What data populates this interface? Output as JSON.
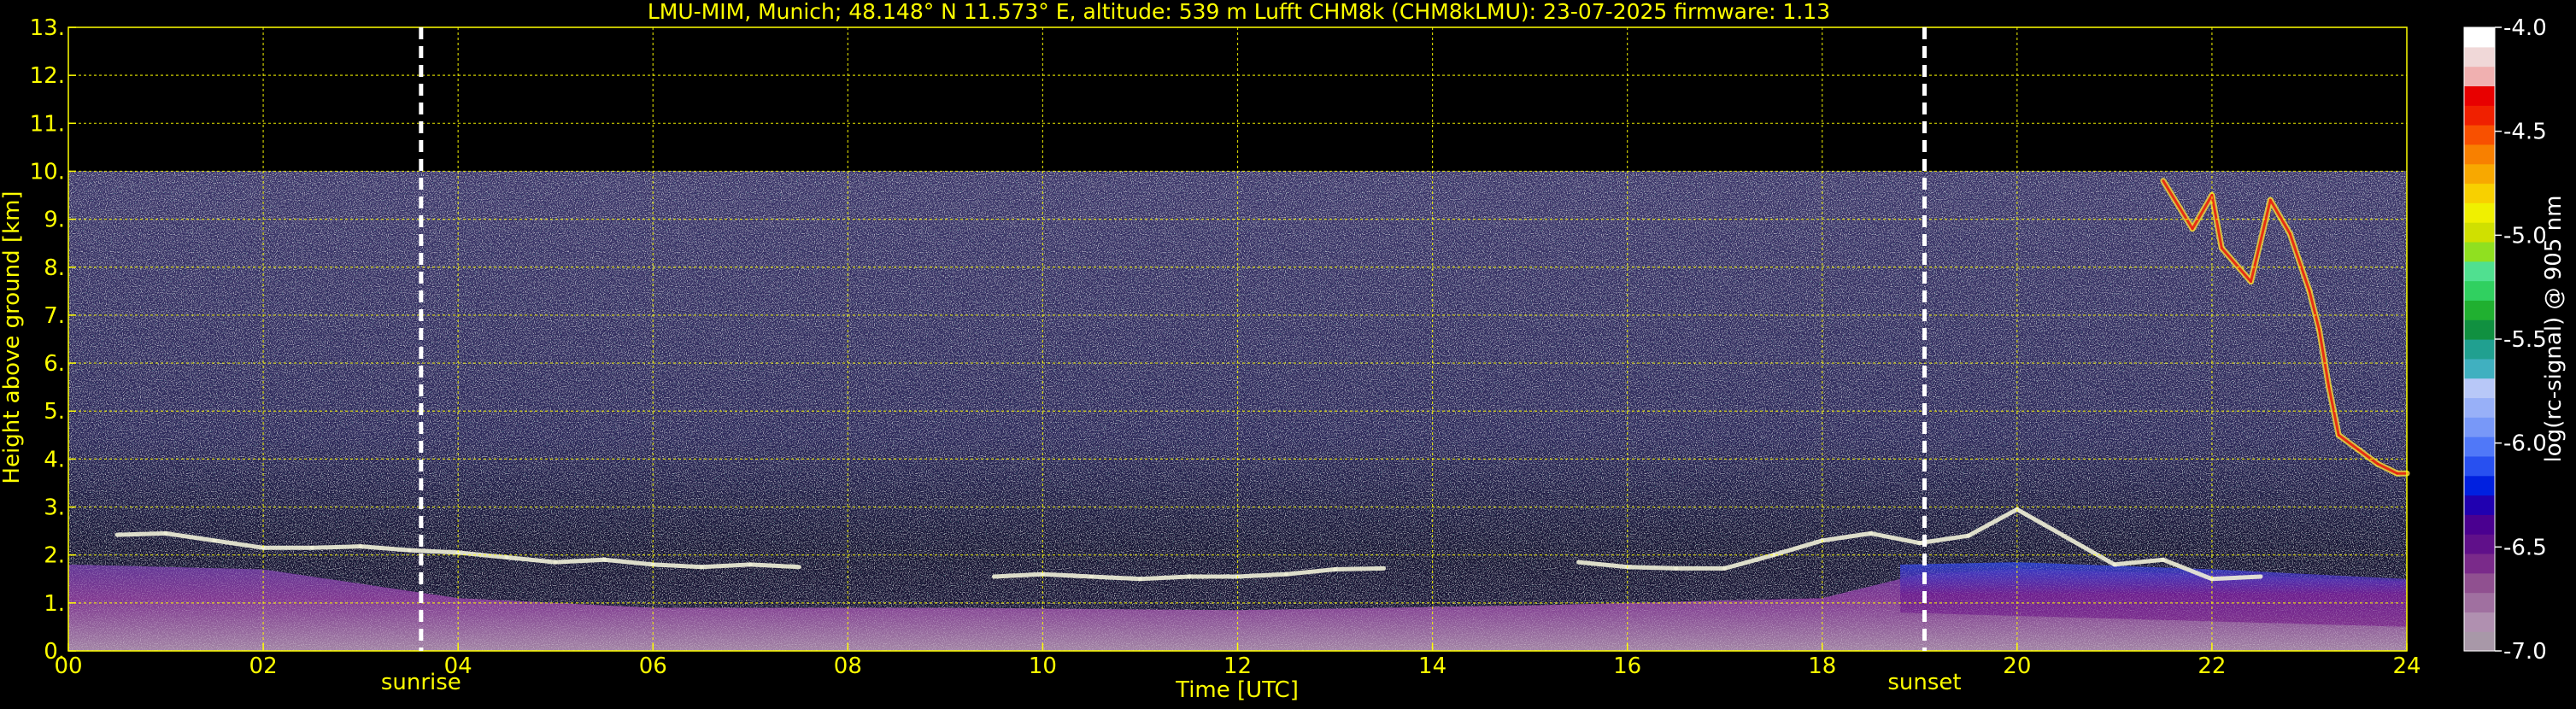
{
  "chart_data": {
    "type": "heatmap",
    "title": "LMU-MIM, Munich; 48.148° N 11.573° E, altitude: 539 m    Lufft CHM8k (CHM8kLMU): 23-07-2025    firmware: 1.13",
    "xlabel": "Time [UTC]",
    "ylabel": "Height above ground [km]",
    "xlim": [
      0,
      24
    ],
    "ylim": [
      0,
      13
    ],
    "xticks": [
      0,
      2,
      4,
      6,
      8,
      10,
      12,
      14,
      16,
      18,
      20,
      22,
      24
    ],
    "xtick_labels": [
      "00",
      "02",
      "04",
      "06",
      "08",
      "10",
      "12",
      "14",
      "16",
      "18",
      "20",
      "22",
      "24"
    ],
    "yticks": [
      0,
      1,
      2,
      3,
      4,
      5,
      6,
      7,
      8,
      9,
      10,
      11,
      12,
      13
    ],
    "ytick_labels": [
      "0.",
      "1.",
      "2.",
      "3.",
      "4.",
      "5.",
      "6.",
      "7.",
      "8.",
      "9.",
      "10.",
      "11.",
      "12.",
      "13."
    ],
    "grid": true,
    "data_top_km": 10,
    "colorbar": {
      "label": "log(rc-signal) @ 905 nm",
      "range": [
        -7.0,
        -4.0
      ],
      "ticks": [
        -7.0,
        -6.5,
        -6.0,
        -5.5,
        -5.0,
        -4.5,
        -4.0
      ],
      "tick_labels": [
        "-7.0",
        "-6.5",
        "-6.0",
        "-5.5",
        "-5.0",
        "-4.5",
        "-4.0"
      ],
      "colors": [
        "#a898a8",
        "#b090b0",
        "#a070a0",
        "#905090",
        "#7a2a8a",
        "#60108a",
        "#4a0090",
        "#2000b0",
        "#0020e0",
        "#2850f0",
        "#5078f8",
        "#7898f8",
        "#98b0f8",
        "#b8c8f8",
        "#40b0c0",
        "#20a090",
        "#109040",
        "#20b030",
        "#30d060",
        "#50e090",
        "#90e020",
        "#d0e000",
        "#f0f000",
        "#f8d000",
        "#f8a800",
        "#f88000",
        "#f85000",
        "#f02000",
        "#e80000",
        "#f0b0b0",
        "#f0d8d8",
        "#ffffff"
      ]
    },
    "events": [
      {
        "label": "sunrise",
        "time_h": 3.62
      },
      {
        "label": "sunset",
        "time_h": 19.05
      }
    ],
    "layers": [
      {
        "kind": "cloud",
        "points": [
          [
            0.5,
            2.42
          ],
          [
            1.0,
            2.45
          ],
          [
            1.5,
            2.3
          ],
          [
            2.0,
            2.15
          ],
          [
            2.5,
            2.15
          ],
          [
            3.0,
            2.18
          ],
          [
            3.5,
            2.1
          ],
          [
            4.0,
            2.05
          ],
          [
            4.5,
            1.95
          ],
          [
            5.0,
            1.85
          ],
          [
            5.5,
            1.9
          ],
          [
            6.0,
            1.8
          ],
          [
            6.5,
            1.75
          ],
          [
            7.0,
            1.8
          ],
          [
            7.5,
            1.75
          ],
          [
            9.5,
            1.55
          ],
          [
            10.0,
            1.6
          ],
          [
            10.5,
            1.55
          ],
          [
            11.0,
            1.5
          ],
          [
            11.5,
            1.55
          ],
          [
            12.0,
            1.55
          ],
          [
            12.5,
            1.6
          ],
          [
            13.0,
            1.7
          ],
          [
            13.5,
            1.72
          ],
          [
            15.5,
            1.85
          ],
          [
            16.0,
            1.75
          ],
          [
            16.5,
            1.72
          ],
          [
            17.0,
            1.72
          ],
          [
            17.5,
            2.0
          ],
          [
            18.0,
            2.3
          ],
          [
            18.5,
            2.45
          ],
          [
            19.0,
            2.25
          ],
          [
            19.5,
            2.4
          ],
          [
            20.0,
            2.95
          ],
          [
            21.0,
            1.8
          ],
          [
            21.5,
            1.9
          ],
          [
            22.0,
            1.5
          ],
          [
            22.5,
            1.55
          ]
        ]
      },
      {
        "kind": "cloud",
        "points": [
          [
            21.5,
            9.8
          ],
          [
            21.8,
            8.8
          ],
          [
            22.0,
            9.5
          ],
          [
            22.1,
            8.4
          ],
          [
            22.4,
            7.7
          ],
          [
            22.6,
            9.4
          ],
          [
            22.8,
            8.7
          ],
          [
            23.0,
            7.5
          ],
          [
            23.1,
            6.7
          ],
          [
            23.2,
            5.5
          ],
          [
            23.3,
            4.5
          ],
          [
            23.5,
            4.2
          ],
          [
            23.7,
            3.9
          ],
          [
            23.9,
            3.7
          ],
          [
            24.0,
            3.7
          ]
        ]
      }
    ]
  }
}
